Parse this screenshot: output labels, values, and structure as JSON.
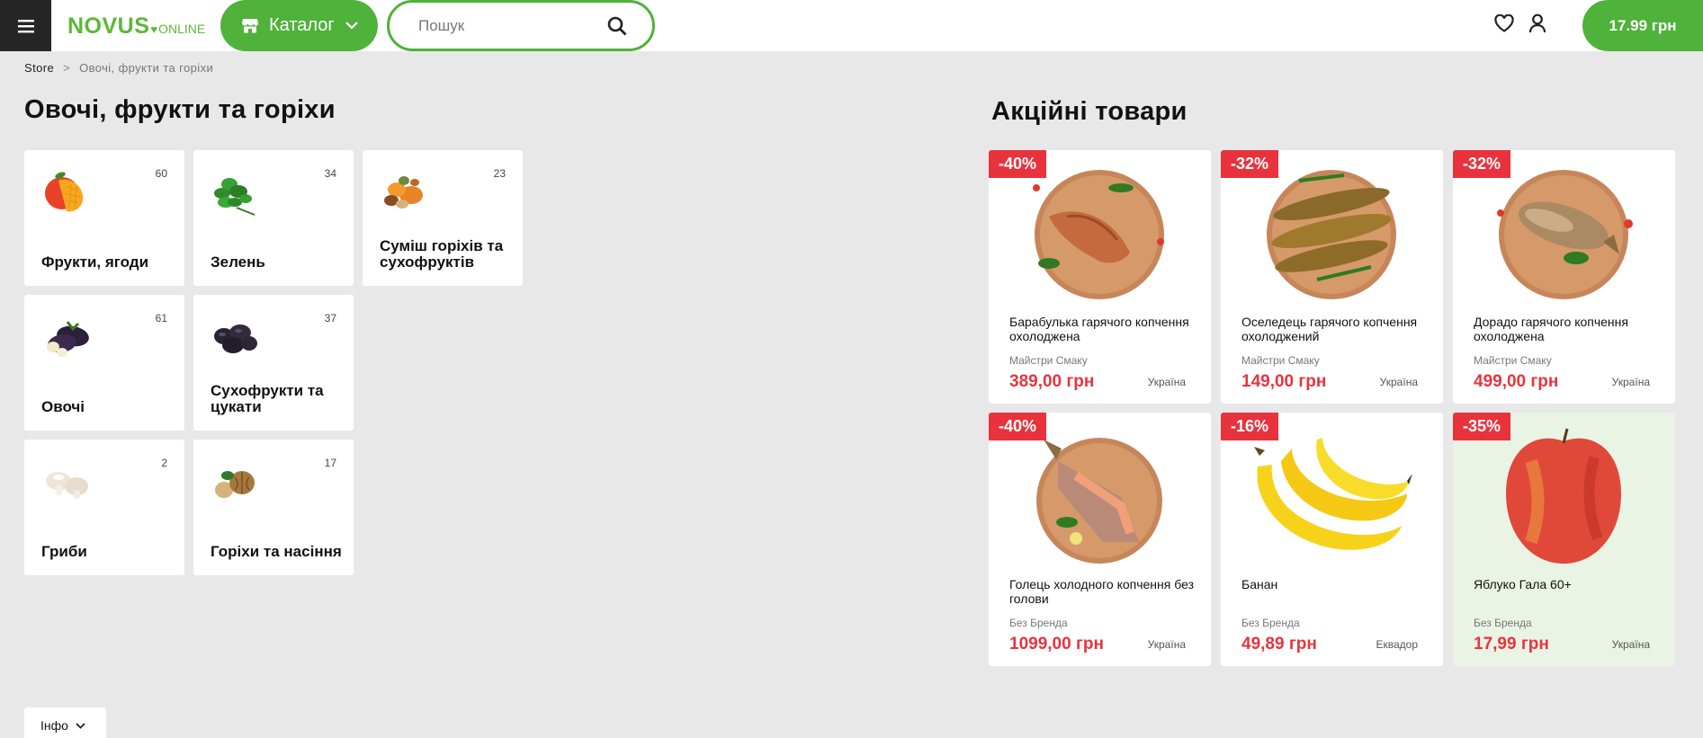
{
  "header": {
    "logo_main": "NOVUS",
    "logo_sub": "ONLINE",
    "catalog_label": "Каталог",
    "search_placeholder": "Пошук",
    "cart_label": "17.99 грн"
  },
  "breadcrumb": {
    "root": "Store",
    "separator": ">",
    "current": "Овочі, фрукти та горіхи"
  },
  "page_title": "Овочі, фрукти та горіхи",
  "categories": [
    {
      "name": "Фрукти, ягоди",
      "count": "60",
      "icon": "mango-icon"
    },
    {
      "name": "Зелень",
      "count": "34",
      "icon": "greens-icon"
    },
    {
      "name": "Суміш горіхів та сухофруктів",
      "count": "23",
      "icon": "dried-fruit-mix-icon"
    },
    {
      "name": "Овочі",
      "count": "61",
      "icon": "eggplant-icon"
    },
    {
      "name": "Сухофрукти та цукати",
      "count": "37",
      "icon": "prunes-icon"
    },
    {
      "name": "Гриби",
      "count": "2",
      "icon": "mushroom-icon"
    },
    {
      "name": "Горіхи та насіння",
      "count": "17",
      "icon": "walnut-icon"
    }
  ],
  "promo_title": "Акційні товари",
  "products": [
    {
      "badge": "-40%",
      "name": "Барабулька гарячого копчення охолоджена",
      "brand": "Майстри Смаку",
      "price": "389,00 грн",
      "country": "Україна"
    },
    {
      "badge": "-32%",
      "name": "Оселедець гарячого копчення охолоджений",
      "brand": "Майстри Смаку",
      "price": "149,00 грн",
      "country": "Україна"
    },
    {
      "badge": "-32%",
      "name": "Дорадо гарячого копчення охолоджена",
      "brand": "Майстри Смаку",
      "price": "499,00 грн",
      "country": "Україна"
    },
    {
      "badge": "-40%",
      "name": "Голець холодного копчення без голови",
      "brand": "Без Бренда",
      "price": "1099,00 грн",
      "country": "Україна"
    },
    {
      "badge": "-16%",
      "name": "Банан",
      "brand": "Без Бренда",
      "price": "49,89 грн",
      "country": "Еквадор"
    },
    {
      "badge": "-35%",
      "name": "Яблуко Гала 60+",
      "brand": "Без Бренда",
      "price": "17,99 грн",
      "country": "Україна"
    }
  ],
  "info_label": "Інфо",
  "colors": {
    "brand_green": "#4fb23b",
    "discount_red": "#e8333d",
    "background": "#e8e8e8"
  }
}
